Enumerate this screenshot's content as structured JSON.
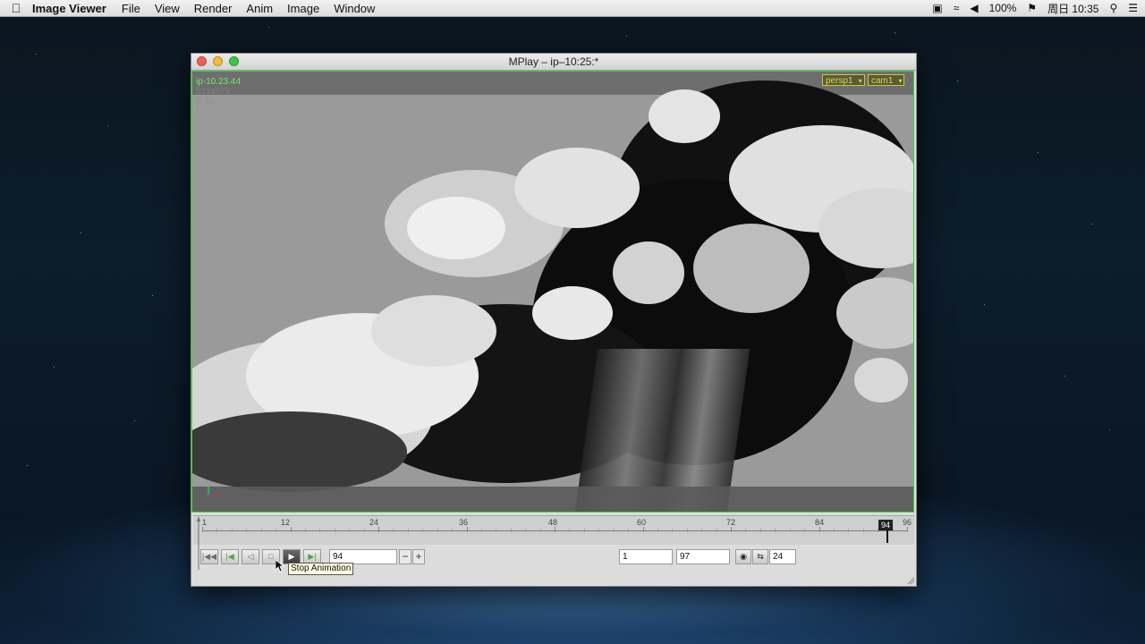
{
  "menubar": {
    "app_name": "Image Viewer",
    "items": [
      "File",
      "View",
      "Render",
      "Anim",
      "Image",
      "Window"
    ],
    "status": {
      "battery": "100%",
      "datetime": "周日 10:35"
    }
  },
  "window": {
    "title": "MPlay – ip–10:25:*"
  },
  "viewport": {
    "timestamp": "ip-10.23.44",
    "hud_line2": "512x579",
    "hud_line3": "fr 93",
    "hud_line4": "C",
    "camera_select": "persp1",
    "camera_name": "cam1"
  },
  "timeline": {
    "labels": [
      "1",
      "12",
      "24",
      "36",
      "48",
      "60",
      "72",
      "84",
      "96"
    ],
    "current_frame": "94"
  },
  "playback": {
    "frame_field": "94",
    "minus_label": "−",
    "plus_label": "+",
    "range_start": "1",
    "range_end": "97",
    "fps": "24",
    "tooltip": "Stop Animation"
  },
  "colors": {
    "viewport_border": "#2ee02e",
    "timestamp": "#6ee86e",
    "camera_select": "#d8d84a"
  }
}
